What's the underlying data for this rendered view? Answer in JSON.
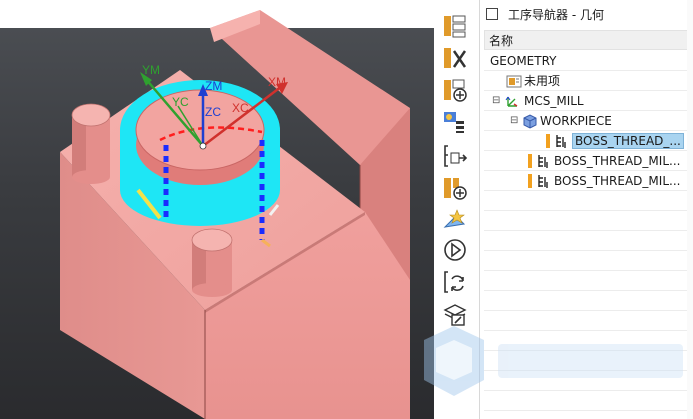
{
  "navigator": {
    "title": "工序导航器 - 几何",
    "column_header": "名称",
    "items": [
      {
        "label": "GEOMETRY",
        "icon": "none"
      },
      {
        "label": "未用项",
        "icon": "unused-items-icon"
      },
      {
        "label": "MCS_MILL",
        "icon": "mcs-csys-icon"
      },
      {
        "label": "WORKPIECE",
        "icon": "workpiece-icon"
      },
      {
        "label": "BOSS_THREAD_...",
        "icon": "thread-milling-operation-icon",
        "selected": true
      },
      {
        "label": "BOSS_THREAD_MIL...",
        "icon": "thread-milling-operation-icon"
      },
      {
        "label": "BOSS_THREAD_MIL...",
        "icon": "thread-milling-operation-icon"
      }
    ]
  },
  "toolbar": {
    "buttons": [
      {
        "name": "program-order-view-button"
      },
      {
        "name": "machine-tool-view-button"
      },
      {
        "name": "geometry-view-button"
      },
      {
        "name": "machining-method-view-button"
      },
      {
        "name": "generate-toolpath-button"
      },
      {
        "name": "create-operation-button"
      },
      {
        "name": "verify-toolpath-button"
      },
      {
        "name": "replay-toolpath-button"
      },
      {
        "name": "post-process-button"
      },
      {
        "name": "shop-docs-button"
      }
    ]
  },
  "viewport": {
    "axes": {
      "ym": "YM",
      "yc": "YC",
      "zm": "ZM",
      "zc": "ZC",
      "xm": "XM",
      "xc": "XC"
    },
    "colors": {
      "part": "#f0a3a0",
      "part_dark": "#d98a88",
      "boss_highlight": "#1ee6f5",
      "toolpath": "#1a2cff",
      "axis_y": "#2fa12f",
      "axis_z": "#1f3fd1",
      "axis_x": "#d0312d"
    }
  },
  "colors": {
    "selection": "#a9d4f0",
    "accent_orange": "#f2a11f"
  }
}
